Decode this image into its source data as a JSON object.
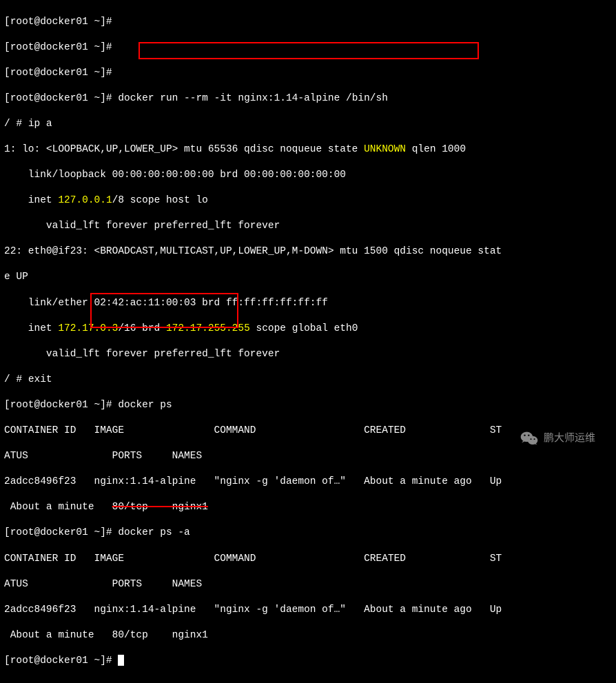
{
  "prompt": "[root@docker01 ~]#",
  "cmd1": "docker run --rm -it nginx:1.14-alpine /bin/sh",
  "sh_prompt": "/ #",
  "ipa_cmd": "ip a",
  "lo_line": "1: lo: <LOOPBACK,UP,LOWER_UP> mtu 65536 qdisc noqueue state ",
  "unknown": "UNKNOWN",
  "lo_line_end": " qlen 1000",
  "lo_link": "    link/loopback 00:00:00:00:00:00 brd 00:00:00:00:00:00",
  "lo_inet_pre": "    inet ",
  "lo_inet_ip": "127.0.0.1",
  "lo_inet_post": "/8 scope host lo",
  "valid1": "       valid_lft forever preferred_lft forever",
  "eth_line": "22: eth0@if23: <BROADCAST,MULTICAST,UP,LOWER_UP,M-DOWN> mtu 1500 qdisc noqueue stat",
  "eth_line2": "e UP",
  "eth_link": "    link/ether 02:42:ac:11:00:03 brd ff:ff:ff:ff:ff:ff",
  "eth_inet_pre": "    inet ",
  "eth_inet_ip": "172.17.0.3",
  "eth_inet_mid": "/16 brd ",
  "eth_inet_brd": "172.17.255.255",
  "eth_inet_post": " scope global eth0",
  "valid2": "       valid_lft forever preferred_lft forever",
  "exit_cmd": "exit",
  "docker_ps": "docker ps",
  "docker_ps_a": "docker ps -a",
  "header1": "CONTAINER ID   IMAGE               COMMAND                  CREATED              ST",
  "header2": "ATUS              PORTS     NAMES",
  "row1": "2adcc8496f23   nginx:1.14-alpine   \"nginx -g 'daemon of…\"   About a minute ago   Up",
  "row2_pre": " About a minute   ",
  "row2_strike": "80/tcp    nginx1",
  "row3": "2adcc8496f23   nginx:1.14-alpine   \"nginx -g 'daemon of…\"   About a minute ago   Up",
  "row4": " About a minute   80/tcp    nginx1",
  "watermark": "鹏大师运维"
}
